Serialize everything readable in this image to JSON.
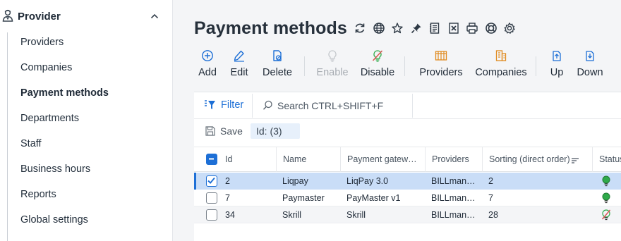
{
  "sidebar": {
    "section_title": "Provider",
    "items": [
      {
        "label": "Providers"
      },
      {
        "label": "Companies"
      },
      {
        "label": "Payment methods",
        "active": true
      },
      {
        "label": "Departments"
      },
      {
        "label": "Staff"
      },
      {
        "label": "Business hours"
      },
      {
        "label": "Reports"
      },
      {
        "label": "Global settings"
      }
    ]
  },
  "page": {
    "title": "Payment methods",
    "title_icons": [
      "refresh-icon",
      "globe-icon",
      "star-icon",
      "pin-icon",
      "notes-icon",
      "export-icon",
      "print-icon",
      "help-ring-icon",
      "gear-icon"
    ]
  },
  "toolbar": {
    "add": "Add",
    "edit": "Edit",
    "delete": "Delete",
    "enable": "Enable",
    "disable": "Disable",
    "providers": "Providers",
    "companies": "Companies",
    "up": "Up",
    "down": "Down"
  },
  "grid": {
    "filter_label": "Filter",
    "search_placeholder": "Search CTRL+SHIFT+F",
    "save_label": "Save",
    "id_chip": "Id: (3)",
    "columns": [
      "Id",
      "Name",
      "Payment gatew…",
      "Providers",
      "Sorting (direct order)",
      "Status"
    ],
    "rows": [
      {
        "id": "2",
        "name": "Liqpay",
        "gateway": "LiqPay 3.0",
        "providers": "BILLman…",
        "sorting": "2",
        "status": "enabled",
        "checked": true,
        "selected": true
      },
      {
        "id": "7",
        "name": "Paymaster",
        "gateway": "PayMaster v1",
        "providers": "BILLman…",
        "sorting": "7",
        "status": "enabled",
        "checked": false,
        "selected": false
      },
      {
        "id": "34",
        "name": "Skrill",
        "gateway": "Skrill",
        "providers": "BILLman…",
        "sorting": "28",
        "status": "disabled",
        "checked": false,
        "selected": false
      }
    ]
  },
  "colors": {
    "accent": "#1d6fd6",
    "selected_row": "#c9ddf7",
    "status_enabled": "#2faa4a",
    "status_disabled": "#d9534f",
    "toolbar_icon": "#1d6fd6",
    "provider_icon": "#e08a1e"
  }
}
